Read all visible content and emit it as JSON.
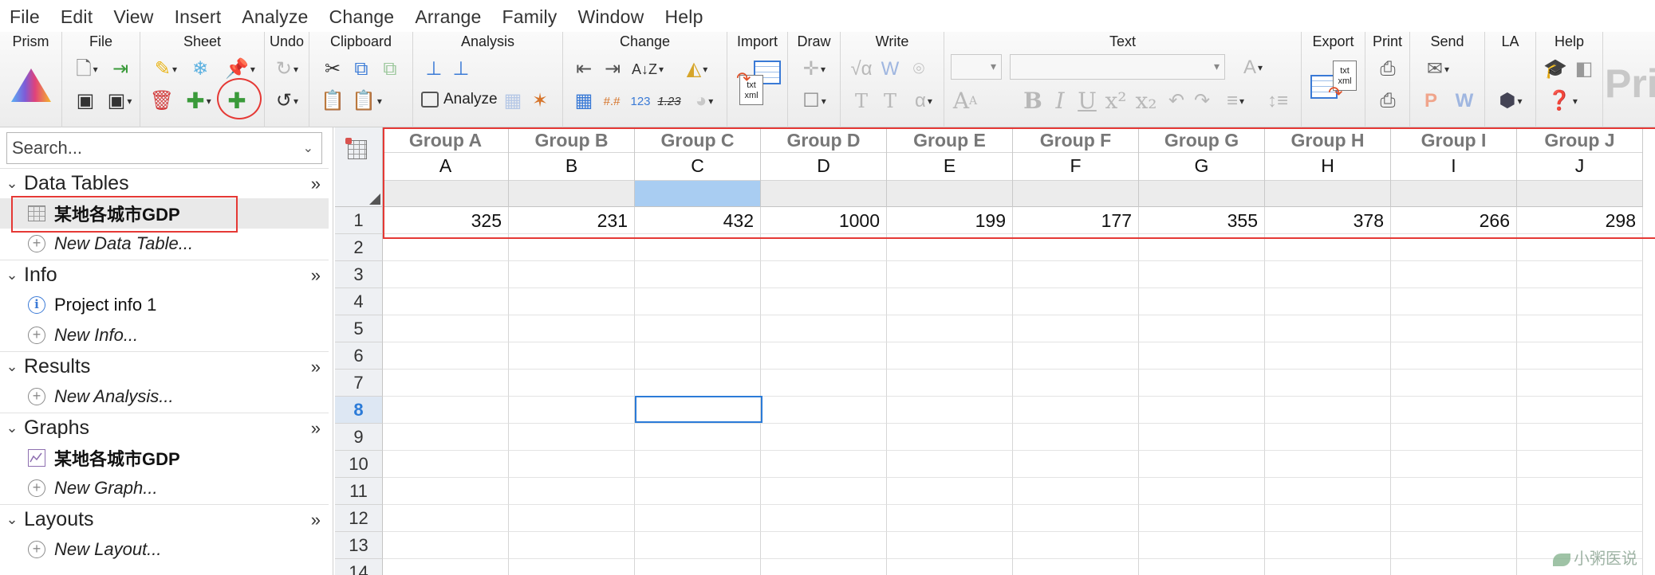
{
  "menu": [
    "File",
    "Edit",
    "View",
    "Insert",
    "Analyze",
    "Change",
    "Arrange",
    "Family",
    "Window",
    "Help"
  ],
  "ribbon": {
    "groups": {
      "prism": "Prism",
      "file": "File",
      "sheet": "Sheet",
      "undo": "Undo",
      "clipboard": "Clipboard",
      "analysis": "Analysis",
      "change": "Change",
      "import": "Import",
      "draw": "Draw",
      "write": "Write",
      "text": "Text",
      "export": "Export",
      "print": "Print",
      "send": "Send",
      "la": "LA",
      "help": "Help"
    },
    "analyze_label": "Analyze",
    "change_123": "123",
    "change_123b": "1.23",
    "change_hash": "#.#",
    "import_badge": "txt xml",
    "export_badge": "txt xml",
    "brand": "Pris",
    "text_buttons": {
      "bold": "B",
      "italic": "I",
      "underline": "U",
      "superscript": "x²",
      "subscript": "x₂"
    }
  },
  "sidebar": {
    "search_placeholder": "Search...",
    "sections": {
      "data_tables": "Data Tables",
      "info": "Info",
      "results": "Results",
      "graphs": "Graphs",
      "layouts": "Layouts"
    },
    "items": {
      "data_table": "某地各城市GDP",
      "new_data_table": "New Data Table...",
      "project_info": "Project info 1",
      "new_info": "New Info...",
      "new_analysis": "New Analysis...",
      "graph": "某地各城市GDP",
      "new_graph": "New Graph...",
      "new_layout": "New Layout..."
    }
  },
  "sheet": {
    "columns": [
      {
        "group": "Group A",
        "letter": "A"
      },
      {
        "group": "Group B",
        "letter": "B"
      },
      {
        "group": "Group C",
        "letter": "C"
      },
      {
        "group": "Group D",
        "letter": "D"
      },
      {
        "group": "Group E",
        "letter": "E"
      },
      {
        "group": "Group F",
        "letter": "F"
      },
      {
        "group": "Group G",
        "letter": "G"
      },
      {
        "group": "Group H",
        "letter": "H"
      },
      {
        "group": "Group I",
        "letter": "I"
      },
      {
        "group": "Group J",
        "letter": "J"
      }
    ],
    "row_numbers": [
      "1",
      "2",
      "3",
      "4",
      "5",
      "6",
      "7",
      "8",
      "9",
      "10",
      "11",
      "12",
      "13",
      "14"
    ],
    "row1_values": [
      "325",
      "231",
      "432",
      "1000",
      "199",
      "177",
      "355",
      "378",
      "266",
      "298"
    ],
    "selected_row": "8",
    "selected_column": "C"
  },
  "watermark": "小粥医说",
  "colors": {
    "highlight_red": "#e53935",
    "selection_blue": "#2b7bd8",
    "column_highlight": "#a9cdf2"
  }
}
